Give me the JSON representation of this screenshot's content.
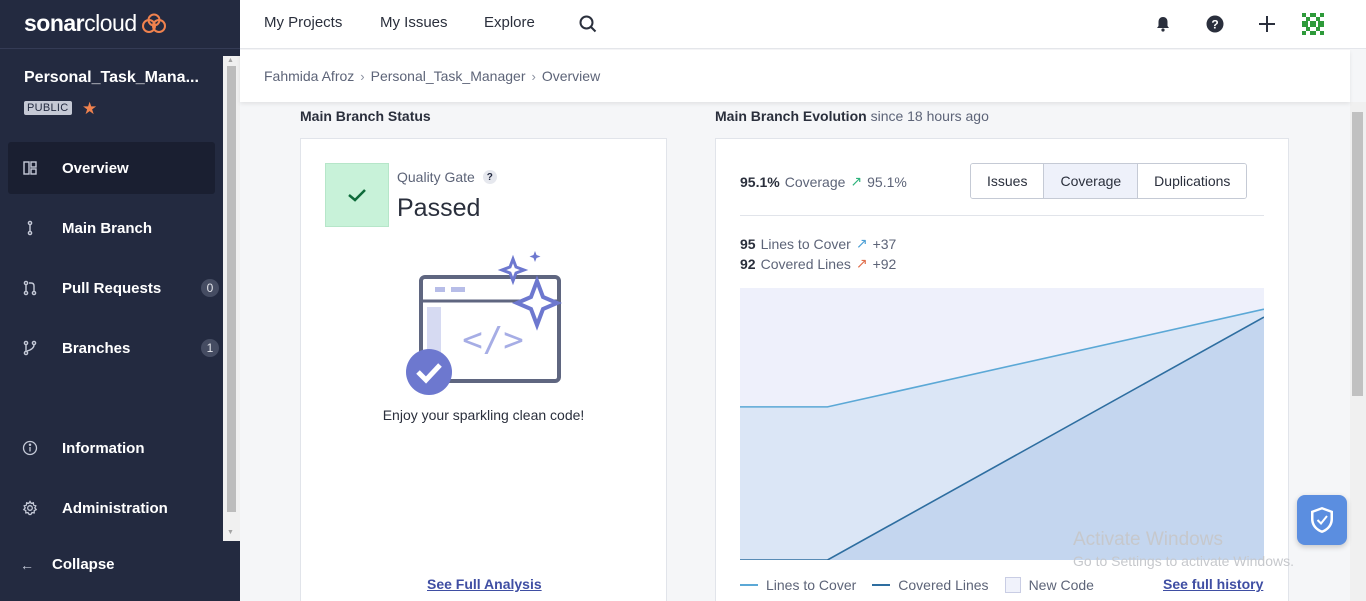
{
  "brand": {
    "name_bold": "sonar",
    "name_light": "cloud"
  },
  "project": {
    "name": "Personal_Task_Mana...",
    "visibility": "PUBLIC"
  },
  "sidebar": {
    "items": [
      {
        "label": "Overview",
        "icon": "overview-grid-icon"
      },
      {
        "label": "Main Branch",
        "icon": "branch-icon"
      },
      {
        "label": "Pull Requests",
        "icon": "pull-request-icon",
        "count": "0"
      },
      {
        "label": "Branches",
        "icon": "branches-icon",
        "count": "1"
      },
      {
        "label": "Information",
        "icon": "info-icon"
      },
      {
        "label": "Administration",
        "icon": "gear-icon"
      }
    ],
    "collapse_label": "Collapse"
  },
  "topnav": {
    "links": [
      "My Projects",
      "My Issues",
      "Explore"
    ]
  },
  "breadcrumb": [
    "Fahmida Afroz",
    "Personal_Task_Manager",
    "Overview"
  ],
  "status_section": {
    "title": "Main Branch Status",
    "quality_gate_label": "Quality Gate",
    "help": "?",
    "status": "Passed",
    "message": "Enjoy your sparkling clean code!",
    "link": "See Full Analysis"
  },
  "evolution_section": {
    "title": "Main Branch Evolution",
    "since": "since 18 hours ago",
    "coverage_value": "95.1%",
    "coverage_label": "Coverage",
    "coverage_delta": "95.1%",
    "tabs": [
      "Issues",
      "Coverage",
      "Duplications"
    ],
    "active_tab": "Coverage",
    "lines_to_cover": {
      "value": "95",
      "label": "Lines to Cover",
      "delta": "+37"
    },
    "covered_lines": {
      "value": "92",
      "label": "Covered Lines",
      "delta": "+92"
    },
    "legend": [
      "Lines to Cover",
      "Covered Lines",
      "New Code"
    ],
    "history_link": "See full history"
  },
  "chart_data": {
    "type": "area",
    "series": [
      {
        "name": "Lines to Cover",
        "values": [
          58,
          58,
          95
        ]
      },
      {
        "name": "Covered Lines",
        "values": [
          0,
          0,
          92
        ]
      }
    ],
    "x_relative": [
      0,
      0.167,
      1
    ],
    "ylim": [
      0,
      100
    ],
    "grid": false
  },
  "watermark": {
    "line1": "Activate Windows",
    "line2": "Go to Settings to activate Windows."
  },
  "colors": {
    "sidebar": "#232a40",
    "accent": "#3f4ea3",
    "passed": "#c8f2d9",
    "lines_to_cover": "#5ba8d6",
    "covered_lines": "#2e6ea0",
    "star": "#f0824e"
  }
}
